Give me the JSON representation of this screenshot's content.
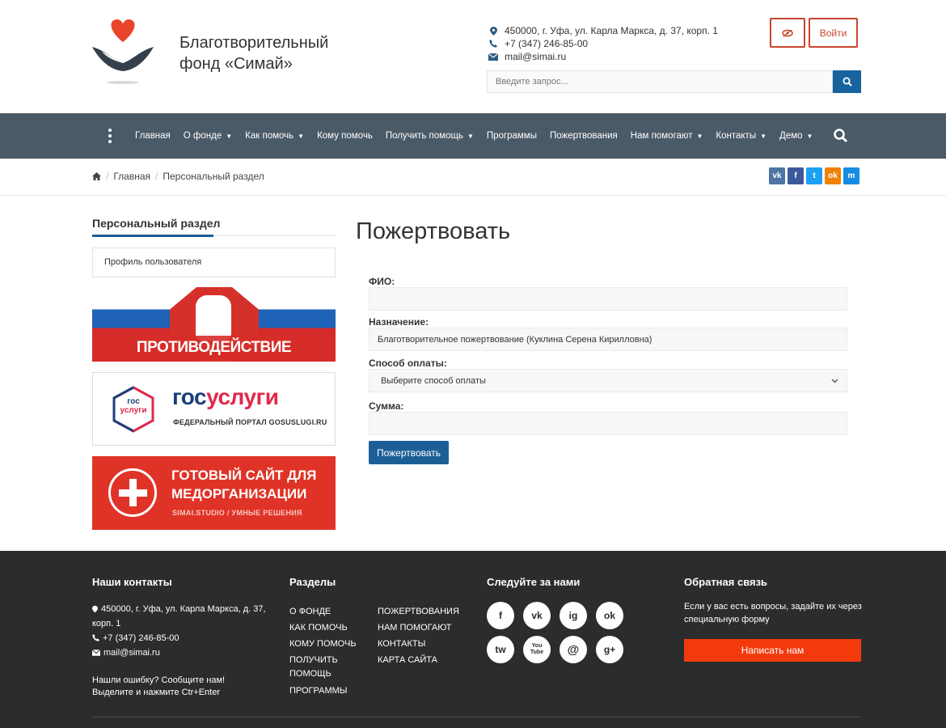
{
  "header": {
    "org_name_line1": "Благотворительный",
    "org_name_line2": "фонд «Симай»",
    "address": "450000, г. Уфа, ул. Карла Маркса, д. 37, корп. 1",
    "phone": "+7 (347) 246-85-00",
    "email": "mail@simai.ru",
    "login_label": "Войти",
    "search_placeholder": "Введите запрос..."
  },
  "nav": {
    "items": [
      {
        "label": "Главная",
        "dropdown": false
      },
      {
        "label": "О фонде",
        "dropdown": true
      },
      {
        "label": "Как помочь",
        "dropdown": true
      },
      {
        "label": "Кому помочь",
        "dropdown": false
      },
      {
        "label": "Получить помощь",
        "dropdown": true
      },
      {
        "label": "Программы",
        "dropdown": false
      },
      {
        "label": "Пожертвования",
        "dropdown": false
      },
      {
        "label": "Нам помогают",
        "dropdown": true
      },
      {
        "label": "Контакты",
        "dropdown": true
      },
      {
        "label": "Демо",
        "dropdown": true
      }
    ]
  },
  "breadcrumb": {
    "home": "Главная",
    "current": "Персональный раздел"
  },
  "social_share": [
    "vk",
    "f",
    "t",
    "ok",
    "m"
  ],
  "sidebar": {
    "title": "Персональный раздел",
    "profile_link": "Профиль пользователя",
    "banner_corruption": "ПРОТИВОДЕЙСТВИЕ КОРРУПЦИИ",
    "banner_gos_small_1": "гос",
    "banner_gos_small_2": "услуги",
    "banner_gos_big_1": "гос",
    "banner_gos_big_2": "услуги",
    "banner_gos_sub": "ФЕДЕРАЛЬНЫЙ ПОРТАЛ GOSUSLUGI.RU",
    "banner_med_title_1": "ГОТОВЫЙ САЙТ ДЛЯ",
    "banner_med_title_2": "МЕДОРГАНИЗАЦИИ",
    "banner_med_sub": "SIMAI.STUDIO / УМНЫЕ РЕШЕНИЯ"
  },
  "main": {
    "title": "Пожертвовать",
    "fio_label": "ФИО:",
    "fio_value": "",
    "purpose_label": "Назначение:",
    "purpose_value": "Благотворительное пожертвование (Куклина Серена Кирилловна)",
    "payment_label": "Способ оплаты:",
    "payment_value": "Выберите способ оплаты",
    "sum_label": "Сумма:",
    "sum_value": "",
    "submit_label": "Пожертвовать"
  },
  "footer": {
    "contacts_title": "Наши контакты",
    "address_line1": "450000, г. Уфа, ул. Карла Маркса, д. 37,",
    "address_line2": "корп. 1",
    "phone": "+7 (347) 246-85-00",
    "email": "mail@simai.ru",
    "error_line1": "Нашли ошибку? Сообщите нам!",
    "error_line2": "Выделите и нажмите Ctr+Enter",
    "sections_title": "Разделы",
    "sections_col1": [
      "О фонде",
      "Как помочь",
      "Кому помочь",
      "Получить помощь",
      "Программы"
    ],
    "sections_col2": [
      "Пожертвования",
      "Нам помогают",
      "Контакты",
      "Карта сайта"
    ],
    "follow_title": "Следуйте за нами",
    "follow_icons": [
      "f",
      "vk",
      "ig",
      "ok",
      "tw",
      "You Tube",
      "@",
      "g+"
    ],
    "feedback_title": "Обратная связь",
    "feedback_text": "Если у вас есть вопросы, задайте их через специальную форму",
    "feedback_button": "Написать нам"
  },
  "colors": {
    "nav_bg": "#4a5a67",
    "primary_blue": "#1c5f97",
    "login_border": "#c8462d",
    "footer_bg": "#2b2c2e",
    "feedback_btn": "#f33a0d"
  }
}
